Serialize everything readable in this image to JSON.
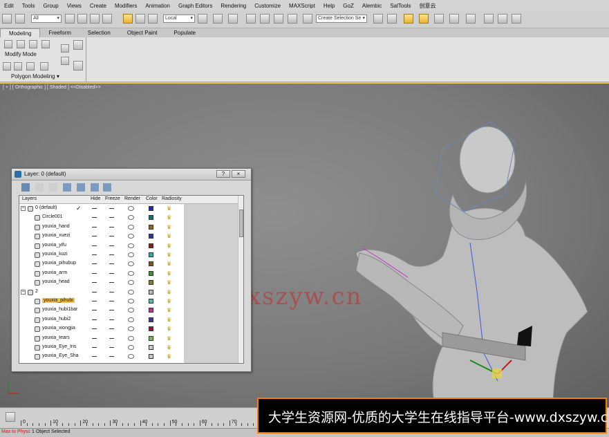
{
  "menu": [
    "Edit",
    "Tools",
    "Group",
    "Views",
    "Create",
    "Modifiers",
    "Animation",
    "Graph Editors",
    "Rendering",
    "Customize",
    "MAXScript",
    "Help",
    "GoZ",
    "Alembic",
    "SalTools",
    "创意云"
  ],
  "toolbar": {
    "filter_value": "All",
    "coord_value": "Local",
    "selection_set_placeholder": "Create Selection Se"
  },
  "ribbon": {
    "tabs": [
      "Modeling",
      "Freeform",
      "Selection",
      "Object Paint",
      "Populate"
    ],
    "modify_mode": "Modify Mode",
    "panel_label": "Polygon Modeling ▾"
  },
  "viewport": {
    "label": "[ + ] [ Orthographic ] [ Shaded ]  <<Disabled>>",
    "watermark": "www.dxszyw.cn"
  },
  "layer_dialog": {
    "title": "Layer: 0 (default)",
    "help_label": "?",
    "close_label": "×",
    "columns": [
      "Layers",
      "Hide",
      "Freeze",
      "Render",
      "Color",
      "Radiosity"
    ],
    "rows": [
      {
        "name": "0 (default)",
        "level": 0,
        "group": true,
        "current": true,
        "color": "#2a2aa0"
      },
      {
        "name": "Circle001",
        "level": 1,
        "color": "#1a6e6e"
      },
      {
        "name": "youxia_hand",
        "level": 1,
        "color": "#8a6a1e"
      },
      {
        "name": "youxia_xuezi",
        "level": 1,
        "color": "#2a3a9a"
      },
      {
        "name": "youxia_yifu",
        "level": 1,
        "color": "#8a1a1a"
      },
      {
        "name": "youxia_kuzi",
        "level": 1,
        "color": "#3aa8a8"
      },
      {
        "name": "youxia_pihubup",
        "level": 1,
        "color": "#7a5a1a"
      },
      {
        "name": "youxia_arm",
        "level": 1,
        "color": "#4a8a3a"
      },
      {
        "name": "youxia_head",
        "level": 1,
        "color": "#8a7a3a"
      },
      {
        "name": "2",
        "level": 0,
        "group": true,
        "color": "#b8b8b8"
      },
      {
        "name": "youxia_pihubi",
        "level": 1,
        "selected": true,
        "color": "#5ab8a8"
      },
      {
        "name": "youxia_hubi1bar",
        "level": 1,
        "color": "#b83a8a"
      },
      {
        "name": "youxia_hubi2",
        "level": 1,
        "color": "#3a3a8a"
      },
      {
        "name": "youxia_xiongjia",
        "level": 1,
        "color": "#8a1a3a"
      },
      {
        "name": "youxia_tears",
        "level": 1,
        "color": "#7ab85a"
      },
      {
        "name": "youxia_Eye_Iris",
        "level": 1,
        "color": "#c8c8c8"
      },
      {
        "name": "youxia_Eye_Sha",
        "level": 1,
        "color": "#c8c8c8"
      }
    ]
  },
  "timeline": {
    "ticks": [
      "0",
      "10",
      "20",
      "30",
      "40",
      "50",
      "60",
      "70"
    ]
  },
  "status": {
    "mode": "Max to Physc",
    "message": "1 Object Selected"
  },
  "banner": {
    "text": "大学生资源网-优质的大学生在线指导平台-www.dxszyw.cn"
  }
}
